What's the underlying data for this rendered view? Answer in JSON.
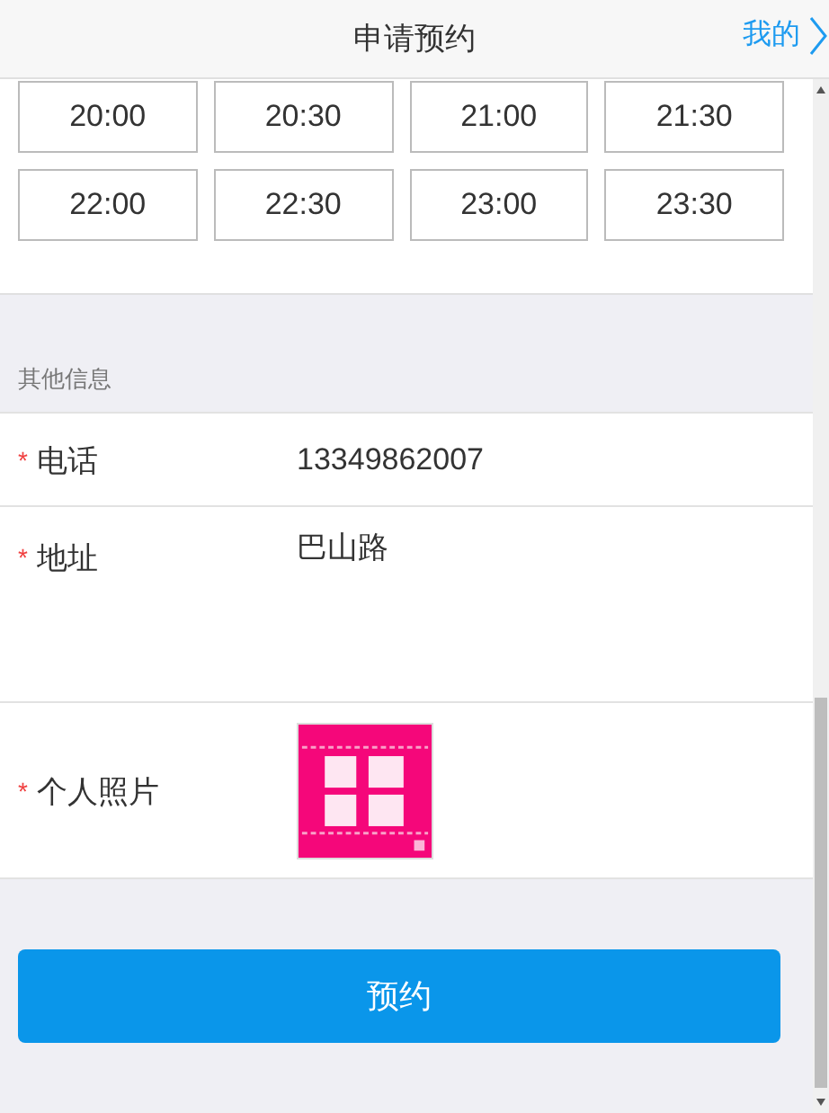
{
  "header": {
    "title": "申请预约",
    "link": "我的"
  },
  "time_slots": [
    "20:00",
    "20:30",
    "21:00",
    "21:30",
    "22:00",
    "22:30",
    "23:00",
    "23:30"
  ],
  "section": {
    "title": "其他信息"
  },
  "fields": [
    {
      "kind": "text",
      "required_mark": "*",
      "label": "电话",
      "value": "13349862007"
    },
    {
      "kind": "textarea",
      "required_mark": "*",
      "label": "地址",
      "value": "巴山路"
    },
    {
      "required_mark": "*",
      "label": "个人照片"
    }
  ],
  "submit": "预约"
}
